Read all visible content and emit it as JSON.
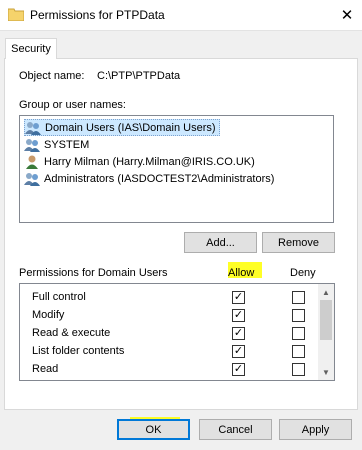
{
  "window": {
    "title": "Permissions for PTPData",
    "close_glyph": "✕"
  },
  "tab": {
    "label": "Security"
  },
  "object": {
    "label": "Object name:",
    "value": "C:\\PTP\\PTPData"
  },
  "groups": {
    "label": "Group or user names:",
    "items": [
      {
        "name": "Domain Users (IAS\\Domain Users)",
        "icon": "group-icon",
        "selected": true
      },
      {
        "name": "SYSTEM",
        "icon": "group-icon",
        "selected": false
      },
      {
        "name": "Harry Milman (Harry.Milman@IRIS.CO.UK)",
        "icon": "user-icon",
        "selected": false
      },
      {
        "name": "Administrators (IASDOCTEST2\\Administrators)",
        "icon": "group-icon",
        "selected": false
      }
    ]
  },
  "buttons": {
    "add": "Add...",
    "remove": "Remove",
    "ok": "OK",
    "cancel": "Cancel",
    "apply": "Apply"
  },
  "permissions": {
    "label": "Permissions for Domain Users",
    "allow_header": "Allow",
    "deny_header": "Deny",
    "rows": [
      {
        "name": "Full control",
        "allow": true,
        "deny": false
      },
      {
        "name": "Modify",
        "allow": true,
        "deny": false
      },
      {
        "name": "Read & execute",
        "allow": true,
        "deny": false
      },
      {
        "name": "List folder contents",
        "allow": true,
        "deny": false
      },
      {
        "name": "Read",
        "allow": true,
        "deny": false
      }
    ]
  },
  "colors": {
    "highlight": "#ffff00",
    "selection": "#cce8ff",
    "focus_border": "#0078d7"
  }
}
